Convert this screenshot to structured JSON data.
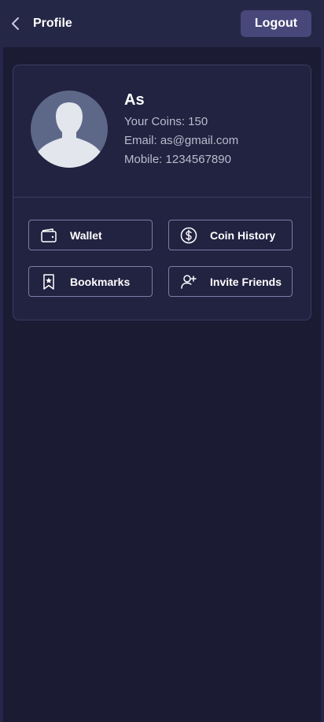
{
  "header": {
    "back_icon": "chevron-left-icon",
    "title": "Profile",
    "logout_label": "Logout"
  },
  "profile": {
    "avatar_icon": "user-silhouette-icon",
    "name": "As",
    "coins_line": "Your Coins: 150",
    "email_line": "Email: as@gmail.com",
    "mobile_line": "Mobile: 1234567890"
  },
  "actions": [
    {
      "label": "Wallet",
      "icon": "wallet-icon"
    },
    {
      "label": "Coin History",
      "icon": "dollar-circle-icon"
    },
    {
      "label": "Bookmarks",
      "icon": "bookmark-star-icon"
    },
    {
      "label": "Invite Friends",
      "icon": "user-plus-icon"
    }
  ],
  "colors": {
    "background": "#1b1b33",
    "header": "#252746",
    "card": "#222241",
    "logout_button": "#47477a",
    "avatar_bg": "#5d6889",
    "secondary_text": "#b9bccc"
  }
}
